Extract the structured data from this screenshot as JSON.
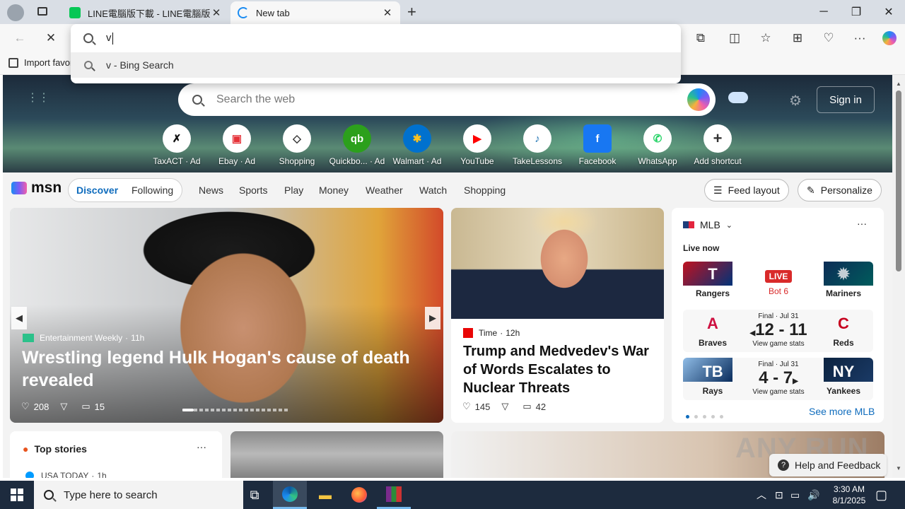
{
  "tabs": [
    {
      "title": "LINE電腦版下載 - LINE電腦版下載",
      "favicon_color": "#06c755"
    },
    {
      "title": "New tab",
      "favicon_color": "#1b8cf2"
    }
  ],
  "omnibox": {
    "typed": "v",
    "suggestion": "v - Bing Search"
  },
  "favorites": {
    "import_label": "Import favor"
  },
  "hero": {
    "search_placeholder": "Search the web",
    "sign_in": "Sign in",
    "shortcuts": [
      {
        "label": "TaxACT · Ad",
        "glyph": "✗",
        "color": "#111"
      },
      {
        "label": "Ebay · Ad",
        "glyph": "🛍",
        "color": "#e53238"
      },
      {
        "label": "Shopping",
        "glyph": "◇",
        "color": "#333"
      },
      {
        "label": "Quickbo...",
        "glyph": "qb",
        "color": "#2ca01c"
      },
      {
        "label": "Walmart · Ad",
        "glyph": "✱",
        "color": "#ffc220"
      },
      {
        "label": "YouTube",
        "glyph": "▶",
        "color": "#ff0000"
      },
      {
        "label": "TakeLessons",
        "glyph": "♪",
        "color": "#1d73b3"
      },
      {
        "label": "Facebook",
        "glyph": "f",
        "color": "#1877f2"
      },
      {
        "label": "WhatsApp",
        "glyph": "✆",
        "color": "#25d366"
      },
      {
        "label": "Add shortcut",
        "glyph": "+",
        "color": "#333"
      }
    ],
    "ad_label": "Ad"
  },
  "nav": {
    "brand": "msn",
    "tabs": [
      "Discover",
      "Following"
    ],
    "links": [
      "News",
      "Sports",
      "Play",
      "Money",
      "Weather",
      "Watch",
      "Shopping"
    ],
    "feed_layout": "Feed layout",
    "personalize": "Personalize"
  },
  "story_main": {
    "source": "Entertainment Weekly",
    "age": "11h",
    "headline": "Wrestling legend Hulk Hogan's cause of death revealed",
    "likes": "208",
    "comments": "15"
  },
  "story_second": {
    "source": "Time",
    "age": "12h",
    "headline": "Trump and Medvedev's War of Words Escalates to Nuclear Threats",
    "likes": "145",
    "comments": "42"
  },
  "mlb": {
    "title": "MLB",
    "live_now": "Live now",
    "games": [
      {
        "away": "Rangers",
        "home": "Mariners",
        "status": "LIVE",
        "detail": "Bot 6",
        "score": "",
        "sub": ""
      },
      {
        "away": "Braves",
        "home": "Reds",
        "status": "Final · Jul 31",
        "detail": "",
        "score": "12 - 11",
        "sub": "View game stats"
      },
      {
        "away": "Rays",
        "home": "Yankees",
        "status": "Final · Jul 31",
        "detail": "",
        "score": "4 - 7",
        "sub": "View game stats"
      }
    ],
    "see_more": "See more MLB"
  },
  "top_stories": {
    "title": "Top stories",
    "source": "USA TODAY",
    "age": "1h"
  },
  "help_feedback": "Help and Feedback",
  "watermark": "ANY RUN",
  "taskbar": {
    "search_placeholder": "Type here to search",
    "time": "3:30 AM",
    "date": "8/1/2025"
  }
}
